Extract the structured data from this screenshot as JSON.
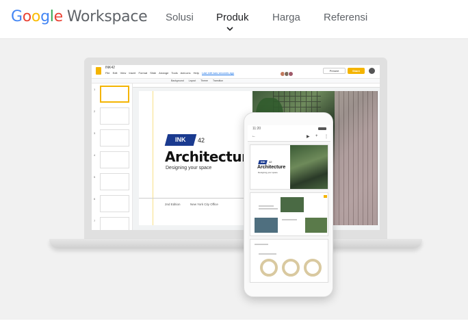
{
  "nav": {
    "logo_google": [
      "G",
      "o",
      "o",
      "g",
      "l",
      "e"
    ],
    "logo_workspace": "Workspace",
    "links": [
      "Solusi",
      "Produk",
      "Harga",
      "Referensi"
    ],
    "active": "Produk"
  },
  "slides_app": {
    "doc_title": "INK42",
    "menu": [
      "File",
      "Edit",
      "View",
      "Insert",
      "Format",
      "Slide",
      "Arrange",
      "Tools",
      "Add-ons",
      "Help"
    ],
    "last_edit": "Last edit was seconds ago",
    "present_label": "Present",
    "share_label": "Share",
    "toolbar": [
      "Background",
      "Layout",
      "Theme",
      "Transition"
    ],
    "slide_numbers": [
      "1",
      "2",
      "3",
      "4",
      "5",
      "6",
      "7"
    ]
  },
  "slide": {
    "ink_label": "INK",
    "ink_number": "42",
    "title": "Architecture",
    "subtitle": "Designing your space",
    "footer_edition": "2nd Edition",
    "footer_city": "New York City Office"
  },
  "phone": {
    "time": "11:20",
    "slide_title": "Architecture",
    "ink_label": "INK",
    "ink_number": "42",
    "slide_subtitle": "Designing your space"
  }
}
